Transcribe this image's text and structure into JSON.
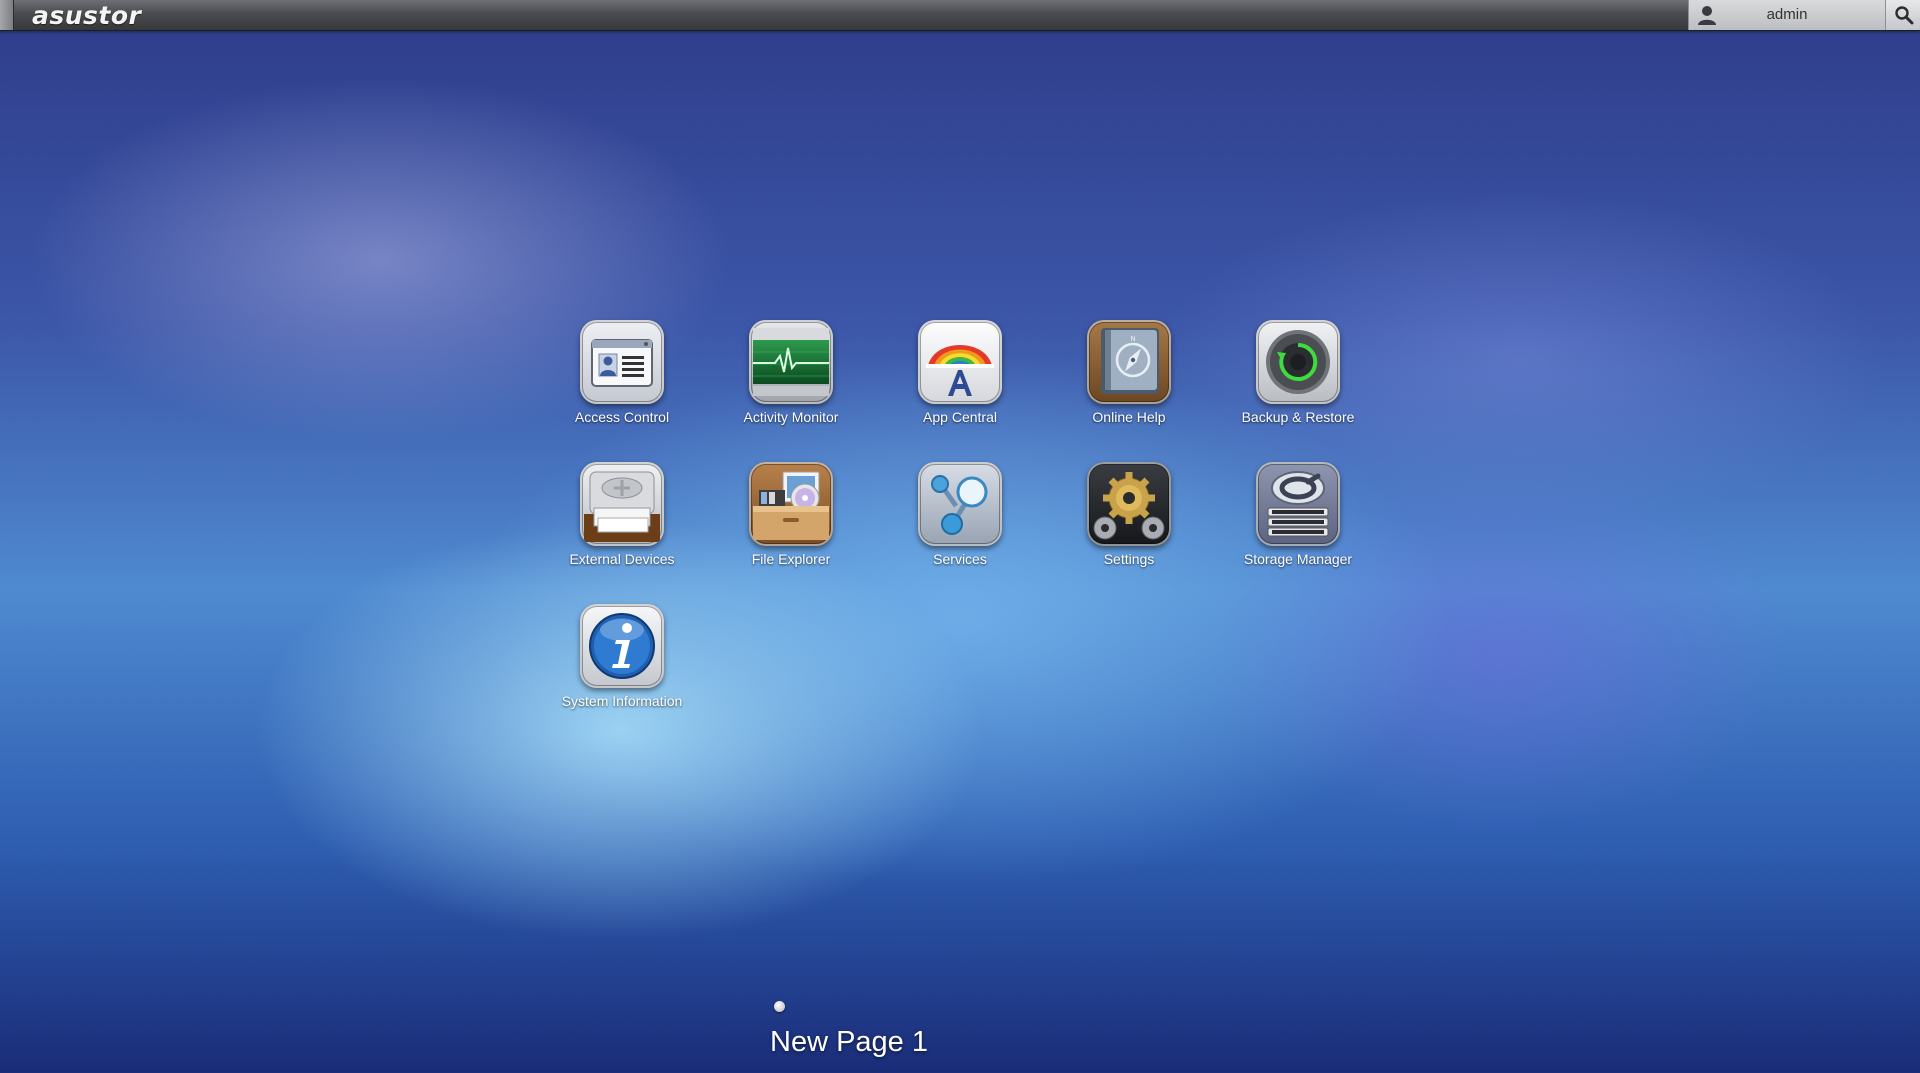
{
  "topbar": {
    "logo": "asustor",
    "username": "admin"
  },
  "apps": [
    {
      "label": "Access Control",
      "icon": "access-control-icon"
    },
    {
      "label": "Activity Monitor",
      "icon": "activity-monitor-icon"
    },
    {
      "label": "App Central",
      "icon": "app-central-icon"
    },
    {
      "label": "Online Help",
      "icon": "online-help-icon"
    },
    {
      "label": "Backup & Restore",
      "icon": "backup-restore-icon"
    },
    {
      "label": "External Devices",
      "icon": "external-devices-icon"
    },
    {
      "label": "File Explorer",
      "icon": "file-explorer-icon"
    },
    {
      "label": "Services",
      "icon": "services-icon"
    },
    {
      "label": "Settings",
      "icon": "settings-icon"
    },
    {
      "label": "Storage Manager",
      "icon": "storage-manager-icon"
    },
    {
      "label": "System Information",
      "icon": "system-information-icon"
    }
  ],
  "pager": {
    "page_name": "New Page 1"
  }
}
